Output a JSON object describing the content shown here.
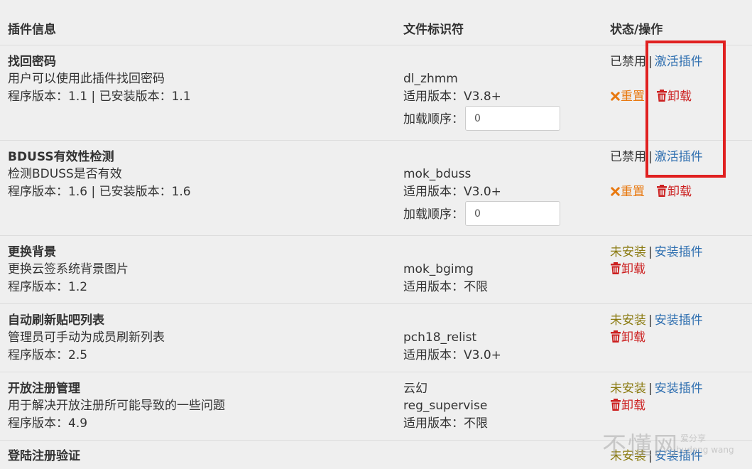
{
  "header": {
    "col_plugin": "插件信息",
    "col_file": "文件标识符",
    "col_status": "状态/操作"
  },
  "plugins": [
    {
      "name": "找回密码",
      "desc": "用户可以使用此插件找回密码",
      "version": "程序版本：1.1 | 已安装版本：1.1",
      "file_id": "dl_zhmm",
      "compat": "适用版本：V3.8+",
      "load_order_label": "加载顺序：",
      "load_order": "0",
      "status": "已禁用",
      "action": "激活插件",
      "reset": "重置",
      "uninstall": "卸载"
    },
    {
      "name": "BDUSS有效性检测",
      "desc": "检测BDUSS是否有效",
      "version": "程序版本：1.6 | 已安装版本：1.6",
      "file_id": "mok_bduss",
      "compat": "适用版本：V3.0+",
      "load_order_label": "加载顺序：",
      "load_order": "0",
      "status": "已禁用",
      "action": "激活插件",
      "reset": "重置",
      "uninstall": "卸载"
    },
    {
      "name": "更换背景",
      "desc": "更换云签系统背景图片",
      "version": "程序版本：1.2",
      "file_id": "mok_bgimg",
      "compat": "适用版本：不限",
      "status": "未安装",
      "action": "安装插件",
      "uninstall": "卸载"
    },
    {
      "name": "自动刷新贴吧列表",
      "desc": "管理员可手动为成员刷新列表",
      "version": "程序版本：2.5",
      "file_id": "pch18_relist",
      "compat": "适用版本：V3.0+",
      "status": "未安装",
      "action": "安装插件",
      "uninstall": "卸载"
    },
    {
      "name": "开放注册管理",
      "desc": "用于解决开放注册所可能导致的一些问题",
      "version": "程序版本：4.9",
      "author": "云幻",
      "file_id": "reg_supervise",
      "compat": "适用版本：不限",
      "status": "未安装",
      "action": "安装插件",
      "uninstall": "卸载"
    },
    {
      "name": "登陆注册验证",
      "status": "未安装",
      "action": "安装插件"
    }
  ],
  "watermark": {
    "brand": "不懂网",
    "tagline": "爱分享",
    "sub": "budong wang"
  },
  "icons": {
    "reset": "times-icon",
    "uninstall": "trash-icon"
  },
  "colors": {
    "link": "#2f6fb0",
    "uninstall": "#cc2020",
    "reset": "#e8780f",
    "not_installed": "#8a7a10",
    "highlight_box": "#e02020"
  }
}
